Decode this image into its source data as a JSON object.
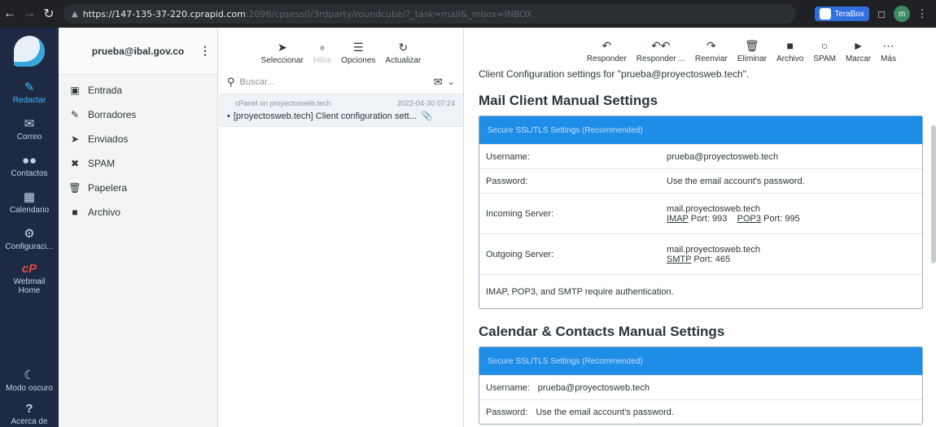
{
  "browser": {
    "url_host": "https://147-135-37-220.cprapid.com",
    "url_rest": ":2096/cpsess0/3rdparty/roundcube/?_task=mail&_mbox=INBOX",
    "extension_label": "TeraBox",
    "profile_initial": "m"
  },
  "taskmenu": {
    "items": [
      {
        "label": "Redactar",
        "icon": "compose-icon"
      },
      {
        "label": "Correo",
        "icon": "mail-icon"
      },
      {
        "label": "Contactos",
        "icon": "contacts-icon"
      },
      {
        "label": "Calendario",
        "icon": "calendar-icon"
      },
      {
        "label": "Configuraci...",
        "icon": "gear-icon"
      },
      {
        "label": "Webmail Home",
        "icon": "cpanel-icon"
      }
    ],
    "bottom": [
      {
        "label": "Modo oscuro",
        "icon": "moon-icon"
      },
      {
        "label": "Acerca de",
        "icon": "help-icon"
      }
    ]
  },
  "folders": {
    "account": "prueba@ibal.gov.co",
    "items": [
      {
        "label": "Entrada",
        "icon": "inbox-icon"
      },
      {
        "label": "Borradores",
        "icon": "pencil-icon"
      },
      {
        "label": "Enviados",
        "icon": "send-icon"
      },
      {
        "label": "SPAM",
        "icon": "spam-icon"
      },
      {
        "label": "Papelera",
        "icon": "trash-icon"
      },
      {
        "label": "Archivo",
        "icon": "archive-icon"
      }
    ]
  },
  "list": {
    "toolbar": [
      {
        "label": "Seleccionar",
        "icon": "pointer-icon"
      },
      {
        "label": "Hilos",
        "icon": "threads-icon"
      },
      {
        "label": "Opciones",
        "icon": "options-icon"
      },
      {
        "label": "Actualizar",
        "icon": "refresh-icon"
      }
    ],
    "search_placeholder": "Buscar...",
    "messages": [
      {
        "from": "cPanel on proyectosweb.tech",
        "date": "2022-04-30 07:24",
        "subject": "[proyectosweb.tech] Client configuration sett..."
      }
    ]
  },
  "reader": {
    "toolbar": [
      {
        "label": "Responder",
        "icon": "reply-icon"
      },
      {
        "label": "Responder ...",
        "icon": "reply-all-icon"
      },
      {
        "label": "Reenviar",
        "icon": "forward-icon"
      },
      {
        "label": "Eliminar",
        "icon": "delete-icon"
      },
      {
        "label": "Archivo",
        "icon": "archive-icon"
      },
      {
        "label": "SPAM",
        "icon": "spam-icon"
      },
      {
        "label": "Marcar",
        "icon": "tag-icon"
      },
      {
        "label": "Más",
        "icon": "more-icon"
      }
    ],
    "intro": "Client Configuration settings for \"prueba@proyectosweb.tech\".",
    "mail_section": {
      "title": "Mail Client Manual Settings",
      "header": "Secure SSL/TLS Settings (Recommended)",
      "username_label": "Username:",
      "username_value": "prueba@proyectosweb.tech",
      "password_label": "Password:",
      "password_value": "Use the email account's password.",
      "incoming_label": "Incoming Server:",
      "incoming_host": "mail.proyectosweb.tech",
      "incoming_imap": "IMAP",
      "incoming_imap_port": "Port: 993",
      "incoming_pop3": "POP3",
      "incoming_pop3_port": "Port: 995",
      "outgoing_label": "Outgoing Server:",
      "outgoing_host": "mail.proyectosweb.tech",
      "outgoing_smtp": "SMTP",
      "outgoing_smtp_port": "Port: 465",
      "auth_note": "IMAP, POP3, and SMTP require authentication."
    },
    "cal_section": {
      "title": "Calendar & Contacts Manual Settings",
      "header": "Secure SSL/TLS Settings (Recommended)",
      "username_label": "Username:",
      "username_value": "prueba@proyectosweb.tech",
      "password_label": "Password:",
      "password_value": "Use the email account's password."
    }
  },
  "colors": {
    "taskmenu_bg": "#1e2a44",
    "accent": "#37beff",
    "section_header": "#1d8de8"
  }
}
